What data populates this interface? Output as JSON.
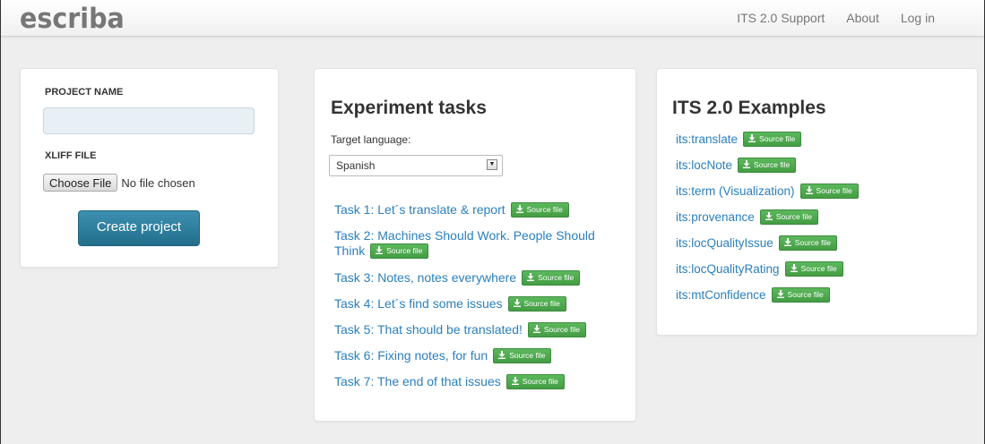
{
  "navbar": {
    "brand": "escriba",
    "links": [
      "ITS 2.0 Support",
      "About",
      "Log in"
    ]
  },
  "project_form": {
    "name_label": "PROJECT NAME",
    "name_value": "",
    "file_label": "XLIFF FILE",
    "choose_file_label": "Choose File",
    "file_status": "No file chosen",
    "create_label": "Create project"
  },
  "tasks": {
    "title": "Experiment tasks",
    "target_label": "Target language:",
    "selected_language": "Spanish",
    "source_label": "Source file",
    "items": [
      "Task 1: Let´s translate & report",
      "Task 2: Machines Should Work. People Should",
      "Think",
      "Task 3: Notes, notes everywhere",
      "Task 4: Let´s find some issues",
      "Task 5: That should be translated!",
      "Task 6: Fixing notes, for fun",
      "Task 7: The end of that issues"
    ]
  },
  "examples": {
    "title": "ITS 2.0 Examples",
    "source_label": "Source file",
    "items": [
      "its:translate",
      "its:locNote",
      "its:term (Visualization)",
      "its:provenance",
      "its:locQualityIssue",
      "its:locQualityRating",
      "its:mtConfidence"
    ]
  },
  "icons": {
    "download": "download-icon",
    "select_arrow": "chevron-down-icon"
  },
  "colors": {
    "link": "#2a7fbe",
    "source_button": "#4cae4c",
    "create_button": "#2f82a3"
  }
}
